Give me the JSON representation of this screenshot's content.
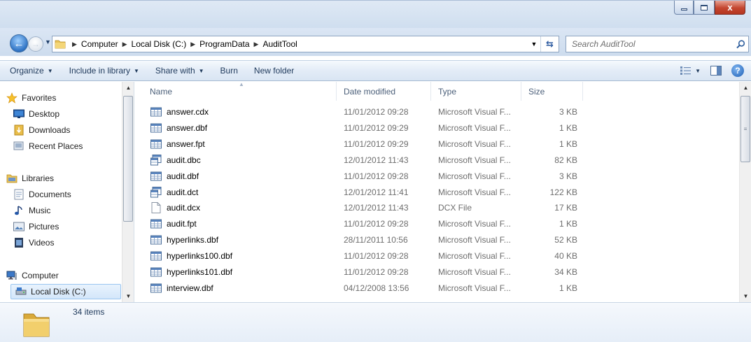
{
  "window": {
    "controls": {
      "close_label": "x"
    }
  },
  "address": {
    "breadcrumb": [
      "Computer",
      "Local Disk (C:)",
      "ProgramData",
      "AuditTool"
    ],
    "search_placeholder": "Search AuditTool"
  },
  "toolbar": {
    "organize": "Organize",
    "include_in_library": "Include in library",
    "share_with": "Share with",
    "burn": "Burn",
    "new_folder": "New folder"
  },
  "nav": {
    "items": [
      {
        "label": "Favorites",
        "icon": "star-icon"
      },
      {
        "label": "Desktop",
        "icon": "desktop-icon"
      },
      {
        "label": "Downloads",
        "icon": "downloads-folder-icon"
      },
      {
        "label": "Recent Places",
        "icon": "recent-places-icon"
      },
      {
        "label": "Libraries",
        "icon": "libraries-icon"
      },
      {
        "label": "Documents",
        "icon": "documents-icon"
      },
      {
        "label": "Music",
        "icon": "music-icon"
      },
      {
        "label": "Pictures",
        "icon": "pictures-icon"
      },
      {
        "label": "Videos",
        "icon": "videos-icon"
      },
      {
        "label": "Computer",
        "icon": "computer-icon"
      },
      {
        "label": "Local Disk (C:)",
        "icon": "drive-icon"
      }
    ]
  },
  "files": {
    "columns": {
      "name": "Name",
      "date": "Date modified",
      "type": "Type",
      "size": "Size"
    },
    "rows": [
      {
        "name": "answer.cdx",
        "date": "11/01/2012 09:28",
        "type": "Microsoft Visual F...",
        "size": "3 KB",
        "icon": "table-file-icon"
      },
      {
        "name": "answer.dbf",
        "date": "11/01/2012 09:29",
        "type": "Microsoft Visual F...",
        "size": "1 KB",
        "icon": "table-file-icon"
      },
      {
        "name": "answer.fpt",
        "date": "11/01/2012 09:29",
        "type": "Microsoft Visual F...",
        "size": "1 KB",
        "icon": "table-file-icon"
      },
      {
        "name": "audit.dbc",
        "date": "12/01/2012 11:43",
        "type": "Microsoft Visual F...",
        "size": "82 KB",
        "icon": "database-file-icon"
      },
      {
        "name": "audit.dbf",
        "date": "11/01/2012 09:28",
        "type": "Microsoft Visual F...",
        "size": "3 KB",
        "icon": "table-file-icon"
      },
      {
        "name": "audit.dct",
        "date": "12/01/2012 11:41",
        "type": "Microsoft Visual F...",
        "size": "122 KB",
        "icon": "database-file-icon"
      },
      {
        "name": "audit.dcx",
        "date": "12/01/2012 11:43",
        "type": "DCX File",
        "size": "17 KB",
        "icon": "blank-file-icon"
      },
      {
        "name": "audit.fpt",
        "date": "11/01/2012 09:28",
        "type": "Microsoft Visual F...",
        "size": "1 KB",
        "icon": "table-file-icon"
      },
      {
        "name": "hyperlinks.dbf",
        "date": "28/11/2011 10:56",
        "type": "Microsoft Visual F...",
        "size": "52 KB",
        "icon": "table-file-icon"
      },
      {
        "name": "hyperlinks100.dbf",
        "date": "11/01/2012 09:28",
        "type": "Microsoft Visual F...",
        "size": "40 KB",
        "icon": "table-file-icon"
      },
      {
        "name": "hyperlinks101.dbf",
        "date": "11/01/2012 09:28",
        "type": "Microsoft Visual F...",
        "size": "34 KB",
        "icon": "table-file-icon"
      },
      {
        "name": "interview.dbf",
        "date": "04/12/2008 13:56",
        "type": "Microsoft Visual F...",
        "size": "1 KB",
        "icon": "table-file-icon"
      }
    ]
  },
  "status": {
    "item_count": "34 items"
  },
  "colors": {
    "accent": "#3d6ea5",
    "selection": "#d3e6fa",
    "secondary_text": "#6d6d6d"
  }
}
